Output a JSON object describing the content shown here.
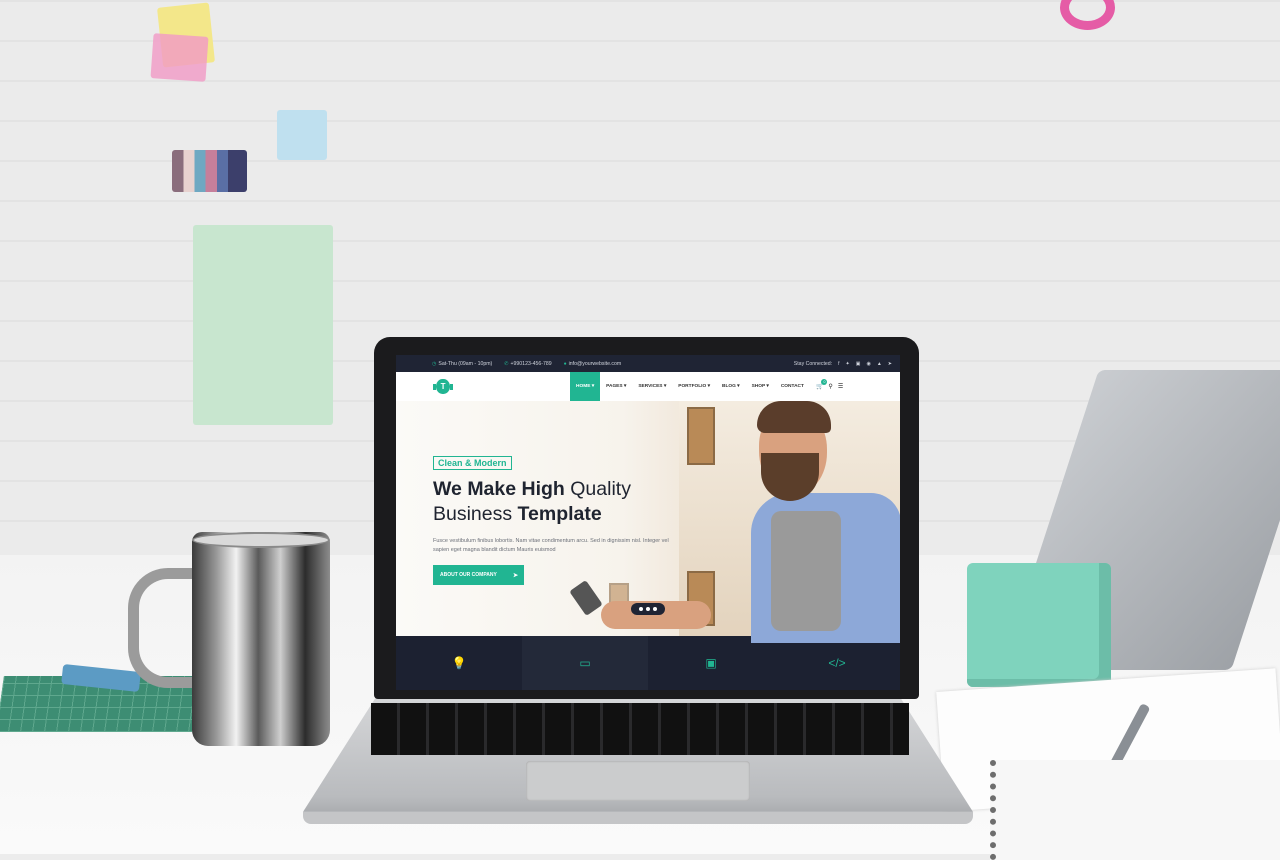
{
  "topbar": {
    "hours": "Sat-Thu (09am - 10pm)",
    "phone": "+990123-456-789",
    "email": "info@yourwebsite.com",
    "stay_connected": "Stay Connected:",
    "social_icons": [
      "facebook-icon",
      "twitter-icon",
      "linkedin-icon",
      "pinterest-icon",
      "youtube-icon",
      "telegram-icon"
    ]
  },
  "logo": {
    "letter": "T"
  },
  "nav": {
    "items": [
      {
        "label": "HOME ▾",
        "active": true
      },
      {
        "label": "PAGES ▾"
      },
      {
        "label": "SERVICES ▾"
      },
      {
        "label": "PORTFOLIO ▾"
      },
      {
        "label": "BLOG ▾"
      },
      {
        "label": "SHOP ▾"
      },
      {
        "label": "CONTACT"
      }
    ],
    "cart_count": "0"
  },
  "hero": {
    "tag": "Clean & Modern",
    "headline_part1_bold": "We Make High",
    "headline_part1_light": " Quality",
    "headline_part2_light": "Business ",
    "headline_part2_bold": "Template",
    "subtext": "Fusce vestibulum finibus lobortis. Nam vitae condimentum arcu. Sed in dignissim nisl. Integer vel sapien eget magna blandit dictum Mauris euismod",
    "cta_label": "ABOUT OUR COMPANY"
  },
  "features": [
    {
      "icon": "lightbulb-icon",
      "glyph": "💡"
    },
    {
      "icon": "monitor-icon",
      "glyph": "▭"
    },
    {
      "icon": "gift-icon",
      "glyph": "▣"
    },
    {
      "icon": "code-icon",
      "glyph": "</>"
    }
  ],
  "colors": {
    "accent": "#21b592",
    "dark": "#1f2434"
  }
}
